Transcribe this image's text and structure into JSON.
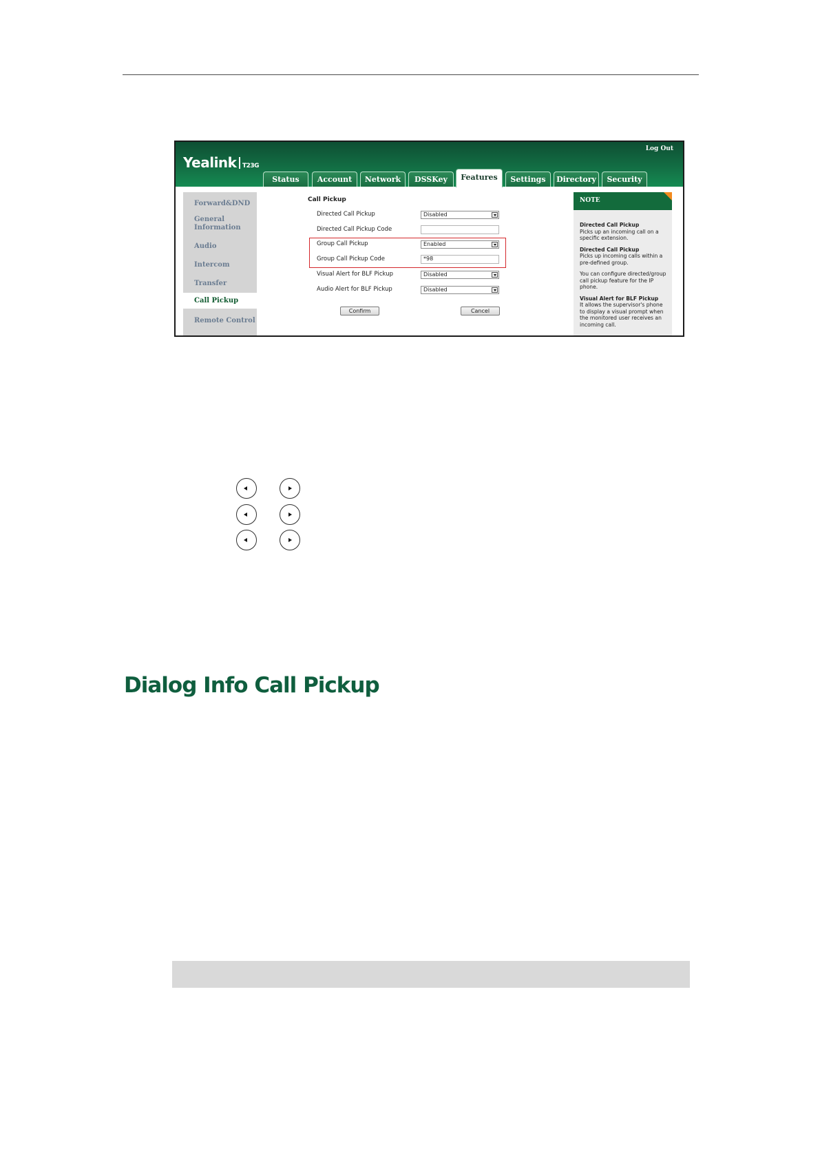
{
  "screenshot": {
    "logo": {
      "brand": "Yealink",
      "model": "T23G"
    },
    "logout": "Log Out",
    "tabs": [
      "Status",
      "Account",
      "Network",
      "DSSKey",
      "Features",
      "Settings",
      "Directory",
      "Security"
    ],
    "active_tab": "Features",
    "sidebar": [
      "Forward&DND",
      "General Information",
      "Audio",
      "Intercom",
      "Transfer",
      "Call Pickup",
      "Remote Control"
    ],
    "active_sidebar": "Call Pickup",
    "form": {
      "title": "Call Pickup",
      "fields": [
        {
          "label": "Directed Call Pickup",
          "type": "select",
          "value": "Disabled"
        },
        {
          "label": "Directed Call Pickup Code",
          "type": "input",
          "value": ""
        },
        {
          "label": "Group Call Pickup",
          "type": "select",
          "value": "Enabled"
        },
        {
          "label": "Group Call Pickup Code",
          "type": "input",
          "value": "*98"
        },
        {
          "label": "Visual Alert for BLF Pickup",
          "type": "select",
          "value": "Disabled"
        },
        {
          "label": "Audio Alert for BLF Pickup",
          "type": "select",
          "value": "Disabled"
        }
      ],
      "confirm": "Confirm",
      "cancel": "Cancel",
      "highlight_color": "#d4272b"
    },
    "note": {
      "heading": "NOTE",
      "items": [
        {
          "title": "Directed Call Pickup",
          "text": "Picks up an incoming call on a specific extension."
        },
        {
          "title": "Directed Call Pickup",
          "text": "Picks up incoming calls within a pre-defined group."
        },
        {
          "title": "",
          "text": "You can configure directed/group call pickup feature for the IP phone."
        },
        {
          "title": "Visual Alert for BLF Pickup",
          "text": "It allows the supervisor's phone to display a visual prompt when the monitored user receives an incoming call."
        }
      ]
    },
    "colors": {
      "header_green": "#137045",
      "note_green": "#136b3c",
      "accent_orange": "#f28a1f"
    }
  },
  "page": {
    "nav_icons": [
      "left-arrow-icon",
      "right-arrow-icon"
    ],
    "section_heading": "Dialog Info Call Pickup"
  }
}
